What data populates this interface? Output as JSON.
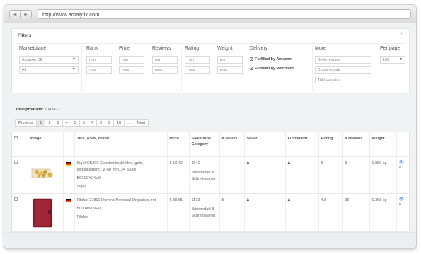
{
  "browser": {
    "back": "◀",
    "forward": "▶",
    "url": "http://www.amalytix.com"
  },
  "filters": {
    "title": "Filters",
    "collapse": "^",
    "marketplace": {
      "label": "Marketplace",
      "value": "Amazon DE",
      "category": "All"
    },
    "rank": {
      "label": "Rank",
      "min": "min",
      "max": "max"
    },
    "price": {
      "label": "Price",
      "min": "min",
      "max": "max"
    },
    "reviews": {
      "label": "Reviews",
      "min": "min",
      "max": "max"
    },
    "rating": {
      "label": "Rating",
      "min": "min",
      "max": "max"
    },
    "weight": {
      "label": "Weight",
      "min": "min",
      "max": "max"
    },
    "delivery": {
      "label": "Delivery",
      "opt1": "Fulfilled by Amazon",
      "opt2": "Fulfilled by Merchant",
      "check": "✓"
    },
    "more": {
      "label": "More",
      "seller": "Seller equals",
      "brand": "Brand equals",
      "title": "Title contains"
    },
    "per_page": {
      "label": "Per page",
      "value": "100"
    }
  },
  "totals": {
    "label": "Total products:",
    "value": "1042472"
  },
  "pagination": [
    "Previous",
    "1",
    "2",
    "3",
    "4",
    "5",
    "6",
    "7",
    "8",
    "9",
    "10",
    "...",
    "Next"
  ],
  "table": {
    "headers": {
      "image": "Image",
      "title": "Title, ASIN, brand",
      "price": "Price",
      "rank": "Sales rank",
      "category": "Category",
      "sellers": "# sellers",
      "seller": "Seller",
      "fulfillment": "Fulfillment",
      "rating": "Rating",
      "reviews": "# reviews",
      "weight": "Weight"
    },
    "rows": [
      {
        "title": "Sigel GB200 Geschenkschleifen, gold, selbstklebend, Ø 60 mm, 24 Stück",
        "asin": "B001CY24VQ",
        "brand": "Sigel",
        "price": "€ 13.42",
        "rank": "3042",
        "category": "Bürobedarf & Schreibwaren",
        "sellers": "",
        "seller": "a",
        "fulfillment": "a",
        "rating": "5",
        "reviews": "3",
        "weight": "0.059 kg"
      },
      {
        "title": "Filofax 27810 Domino Personal Organiser, rot",
        "asin": "B000KN09HQ",
        "brand": "Filofax",
        "price": "€ 33.65",
        "rank": "1173",
        "category": "Bürobedarf & Schreibwaren",
        "sellers": "5",
        "seller": "a",
        "fulfillment": "a",
        "rating": "4.8",
        "reviews": "36",
        "weight": "0.358 kg"
      }
    ],
    "actions": {
      "view": "👁",
      "amazon": "a"
    }
  }
}
